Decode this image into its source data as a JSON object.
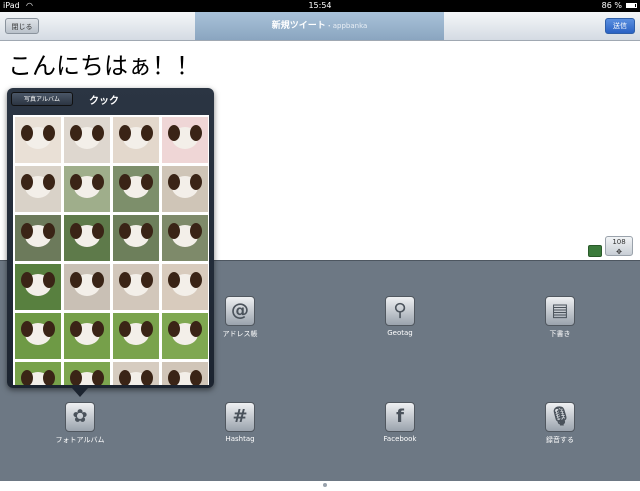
{
  "status_bar": {
    "device": "iPad",
    "time": "15:54",
    "battery": "86 %"
  },
  "nav": {
    "close_label": "閉じる",
    "title": "新規ツイート",
    "separator": "・",
    "account": "appbanka",
    "send_label": "送信"
  },
  "compose": {
    "text": "こんにちはぁ！！",
    "remaining_count": "108",
    "counter_arrow": "✥"
  },
  "popover": {
    "back_label": "写真アルバム",
    "title": "クック",
    "thumbnails": [
      {
        "bg": "#e9e0d6"
      },
      {
        "bg": "#ded7cf"
      },
      {
        "bg": "#e3d8cc"
      },
      {
        "bg": "#efd6d6"
      },
      {
        "bg": "#d9d2c8"
      },
      {
        "bg": "#9fae8b"
      },
      {
        "bg": "#7d8f6b"
      },
      {
        "bg": "#cfc5b7"
      },
      {
        "bg": "#6c7a5b"
      },
      {
        "bg": "#5e7a4a"
      },
      {
        "bg": "#6d7f5b"
      },
      {
        "bg": "#7e8a6a"
      },
      {
        "bg": "#58803f"
      },
      {
        "bg": "#c9c0b5"
      },
      {
        "bg": "#d2c7bb"
      },
      {
        "bg": "#d8cbbd"
      },
      {
        "bg": "#6e9a45"
      },
      {
        "bg": "#76a04a"
      },
      {
        "bg": "#7aa34d"
      },
      {
        "bg": "#7fa851"
      },
      {
        "bg": "#78a24a"
      },
      {
        "bg": "#7da64f"
      },
      {
        "bg": "#d6ccc0"
      },
      {
        "bg": "#d0c5b8"
      }
    ]
  },
  "toolbar": {
    "items": [
      {
        "name": "address-book",
        "label": "アドレス帳",
        "glyph": "@"
      },
      {
        "name": "geotag",
        "label": "Geotag",
        "glyph": "⚲"
      },
      {
        "name": "drafts",
        "label": "下書き",
        "glyph": "▤"
      },
      {
        "name": "photo-album",
        "label": "フォトアルバム",
        "glyph": "✿"
      },
      {
        "name": "hashtag",
        "label": "Hashtag",
        "glyph": "#"
      },
      {
        "name": "facebook",
        "label": "Facebook",
        "glyph": "f"
      },
      {
        "name": "record",
        "label": "録音する",
        "glyph": "🎙"
      }
    ]
  }
}
